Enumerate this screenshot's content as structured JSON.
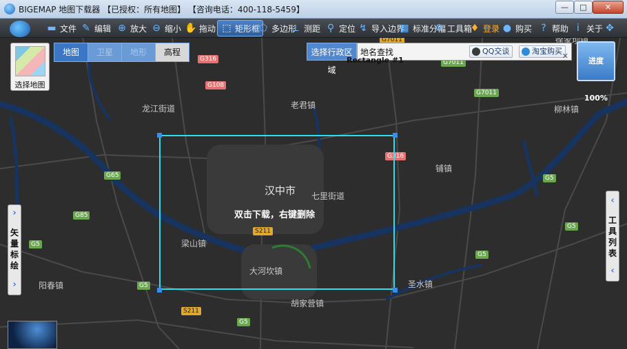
{
  "window": {
    "title": "BIGEMAP 地图下载器 【已授权：所有地图】 【咨询电话：400-118-5459】",
    "minimize": "—",
    "maximize": "□",
    "close": "✕"
  },
  "toolbar": {
    "items": [
      {
        "label": "文件",
        "icon": "folder-icon"
      },
      {
        "label": "编辑",
        "icon": "edit-icon"
      },
      {
        "label": "放大",
        "icon": "zoom-in-icon"
      },
      {
        "label": "缩小",
        "icon": "zoom-out-icon"
      },
      {
        "label": "拖动",
        "icon": "hand-icon"
      },
      {
        "label": "矩形框",
        "icon": "rectangle-select-icon",
        "active": true
      },
      {
        "label": "多边形",
        "icon": "polygon-icon"
      },
      {
        "label": "测距",
        "icon": "ruler-icon"
      },
      {
        "label": "定位",
        "icon": "location-pin-icon"
      },
      {
        "label": "导入边界",
        "icon": "import-boundary-icon"
      },
      {
        "label": "标准分幅",
        "icon": "grid-sheet-icon"
      },
      {
        "label": "工具箱",
        "icon": "toolbox-icon"
      },
      {
        "label": "登录",
        "icon": "login-icon",
        "highlight": true
      },
      {
        "label": "购买",
        "icon": "cart-icon"
      },
      {
        "label": "帮助",
        "icon": "help-icon"
      },
      {
        "label": "关于",
        "icon": "info-icon"
      }
    ]
  },
  "map_controls": {
    "select_map_label": "选择地图",
    "map_types": [
      "地图",
      "卫星",
      "地形",
      "高程"
    ],
    "region_button": "选择行政区域",
    "search_label": "地名查找",
    "qq_chip": "QQ交谈",
    "taobao_chip": "淘宝购买",
    "progress_label": "进度100%",
    "left_tab": "矢量标绘",
    "right_tab": "工具列表"
  },
  "selection": {
    "name": "Rectangle #1",
    "hint": "双击下载，右键删除"
  },
  "map_labels": {
    "places": [
      {
        "name": "汉中市",
        "city": true
      },
      {
        "name": "七里街道"
      },
      {
        "name": "老君镇"
      },
      {
        "name": "龙江街道"
      },
      {
        "name": "柳林镇"
      },
      {
        "name": "铺镇"
      },
      {
        "name": "梁山镇"
      },
      {
        "name": "大河坎镇"
      },
      {
        "name": "阳春镇"
      },
      {
        "name": "圣水镇"
      },
      {
        "name": "胡家营镇"
      },
      {
        "name": "徐家坝镇"
      }
    ],
    "roads": [
      "G316",
      "G108",
      "G7011",
      "G7011",
      "G316",
      "G7011",
      "G65",
      "G85",
      "G5",
      "G5",
      "G5",
      "G5",
      "G5",
      "S211",
      "S211",
      "G5"
    ]
  }
}
